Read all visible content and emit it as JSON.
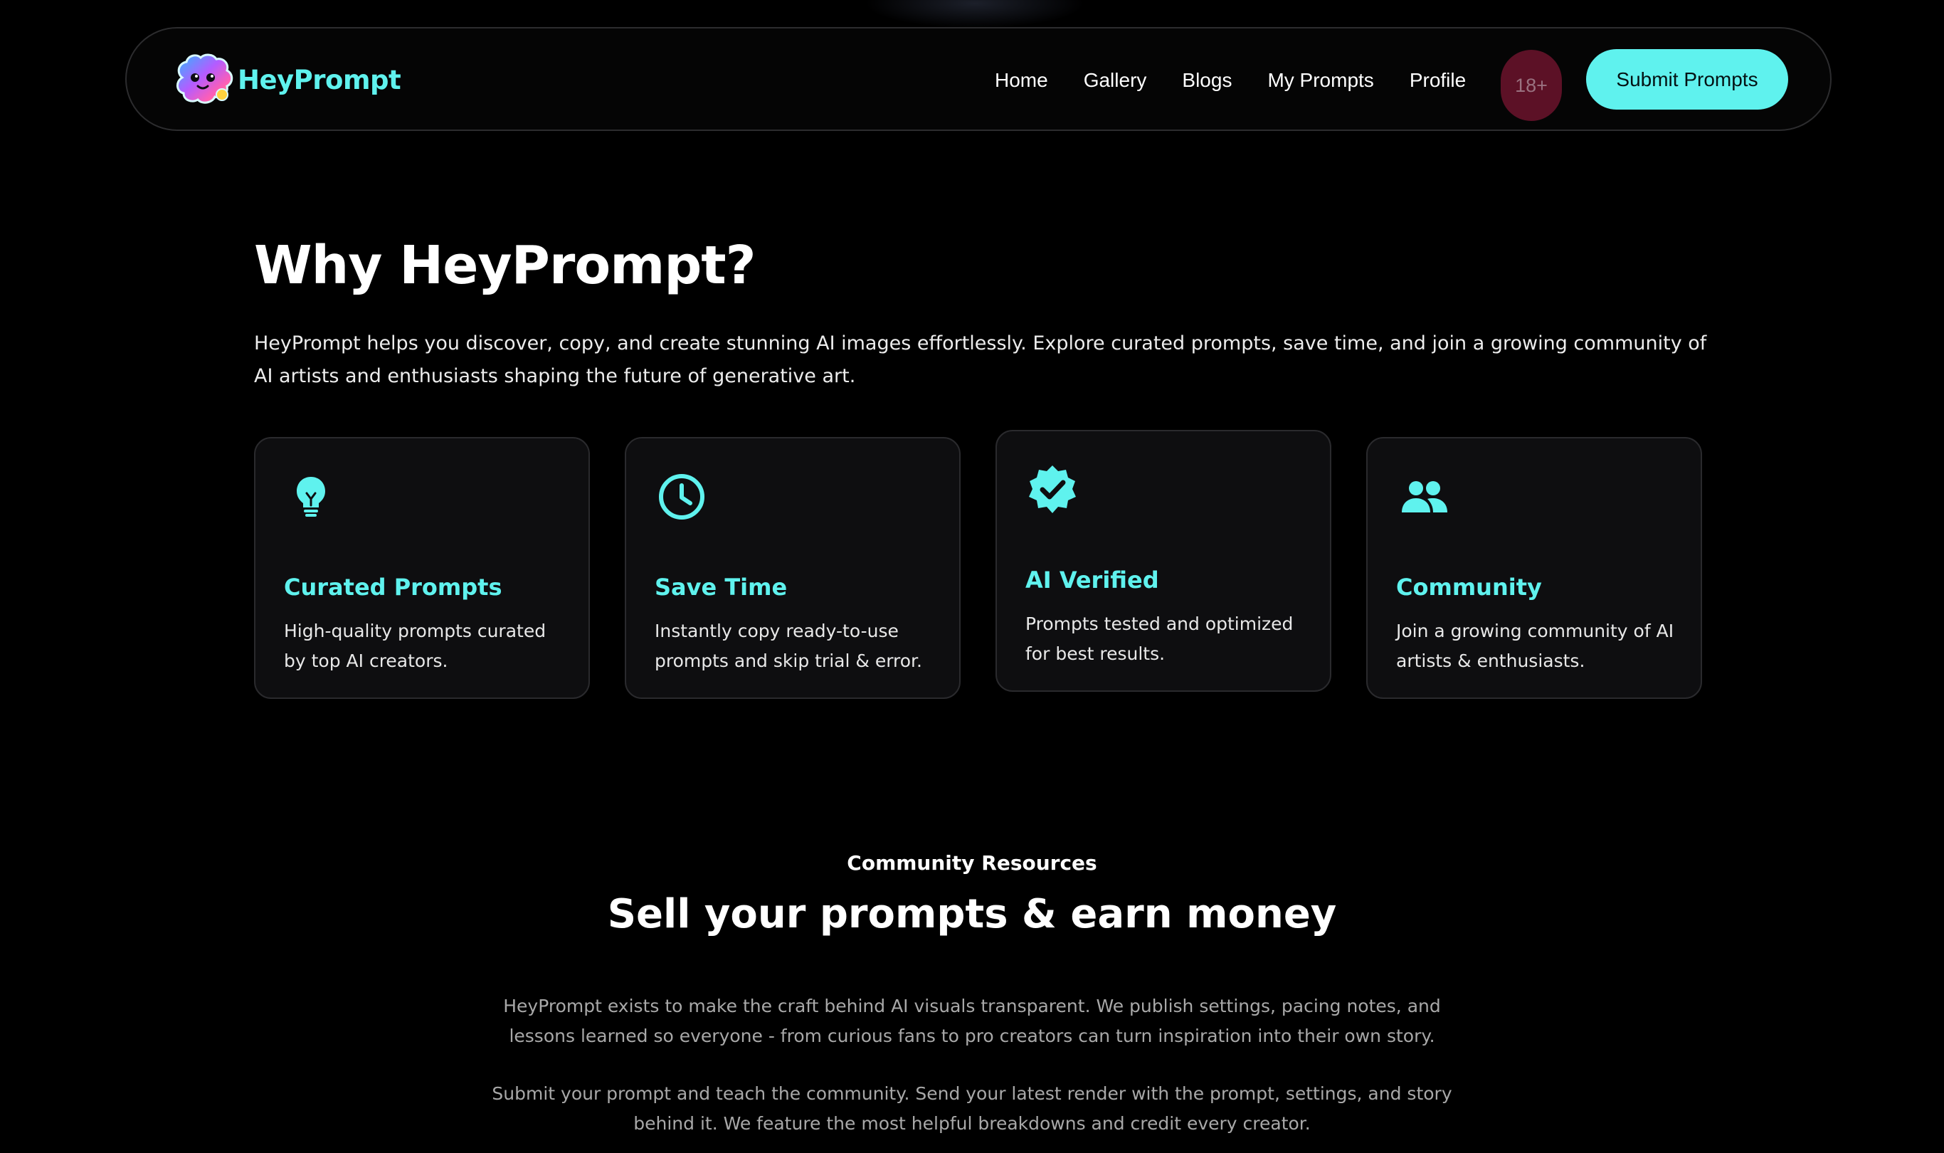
{
  "colors": {
    "background": "#000000",
    "accent": "#5ff2ee",
    "badge": "#5c1126",
    "card": "#0e0e10"
  },
  "nav": {
    "brand": "HeyPrompt",
    "logo_icon": "brain-face-logo",
    "links": [
      "Home",
      "Gallery",
      "Blogs",
      "My Prompts",
      "Profile"
    ],
    "age_badge": "18+",
    "submit_label": "Submit Prompts"
  },
  "why": {
    "title": "Why HeyPrompt?",
    "description": "HeyPrompt helps you discover, copy, and create stunning AI images effortlessly. Explore curated prompts, save time, and join a growing community of AI artists and enthusiasts shaping the future of generative art.",
    "cards": [
      {
        "icon": "lightbulb-icon",
        "title": "Curated Prompts",
        "text": "High-quality prompts curated by top AI creators."
      },
      {
        "icon": "clock-icon",
        "title": "Save Time",
        "text": "Instantly copy ready-to-use prompts and skip trial & error."
      },
      {
        "icon": "verified-badge-icon",
        "title": "AI Verified",
        "text": "Prompts tested and optimized for best results."
      },
      {
        "icon": "people-icon",
        "title": "Community",
        "text": "Join a growing community of AI artists & enthusiasts."
      }
    ]
  },
  "community": {
    "label": "Community Resources",
    "title": "Sell your prompts & earn money",
    "paragraph1": "HeyPrompt exists to make the craft behind AI visuals transparent. We publish settings, pacing notes, and lessons learned so everyone - from curious fans to pro creators can turn inspiration into their own story.",
    "paragraph2": "Submit your prompt and teach the community. Send your latest render with the prompt, settings, and story behind it. We feature the most helpful breakdowns and credit every creator."
  }
}
